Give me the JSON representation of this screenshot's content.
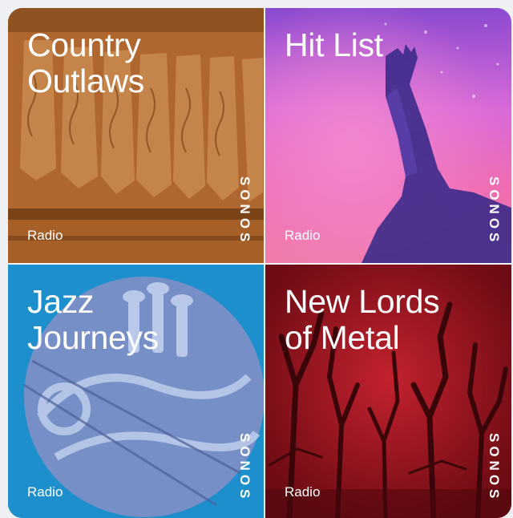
{
  "tiles": [
    {
      "id": "country-outlaws",
      "title_lines": [
        "Country",
        "Outlaws"
      ],
      "subtitle": "Radio",
      "brand": "SONOS",
      "accent": "#b26a34",
      "artwork": "cowboy-boots-image"
    },
    {
      "id": "hit-list",
      "title_lines": [
        "Hit List"
      ],
      "subtitle": "Radio",
      "brand": "SONOS",
      "accent": "#f06cb2",
      "artwork": "concert-raised-hand-image"
    },
    {
      "id": "jazz-journeys",
      "title_lines": [
        "Jazz",
        "Journeys"
      ],
      "subtitle": "Radio",
      "brand": "SONOS",
      "accent": "#1d8fcc",
      "artwork": "trumpet-image"
    },
    {
      "id": "new-lords-of-metal",
      "title_lines": [
        "New Lords",
        "of Metal"
      ],
      "subtitle": "Radio",
      "brand": "SONOS",
      "accent": "#8e121c",
      "artwork": "dark-forest-trees-image"
    }
  ]
}
